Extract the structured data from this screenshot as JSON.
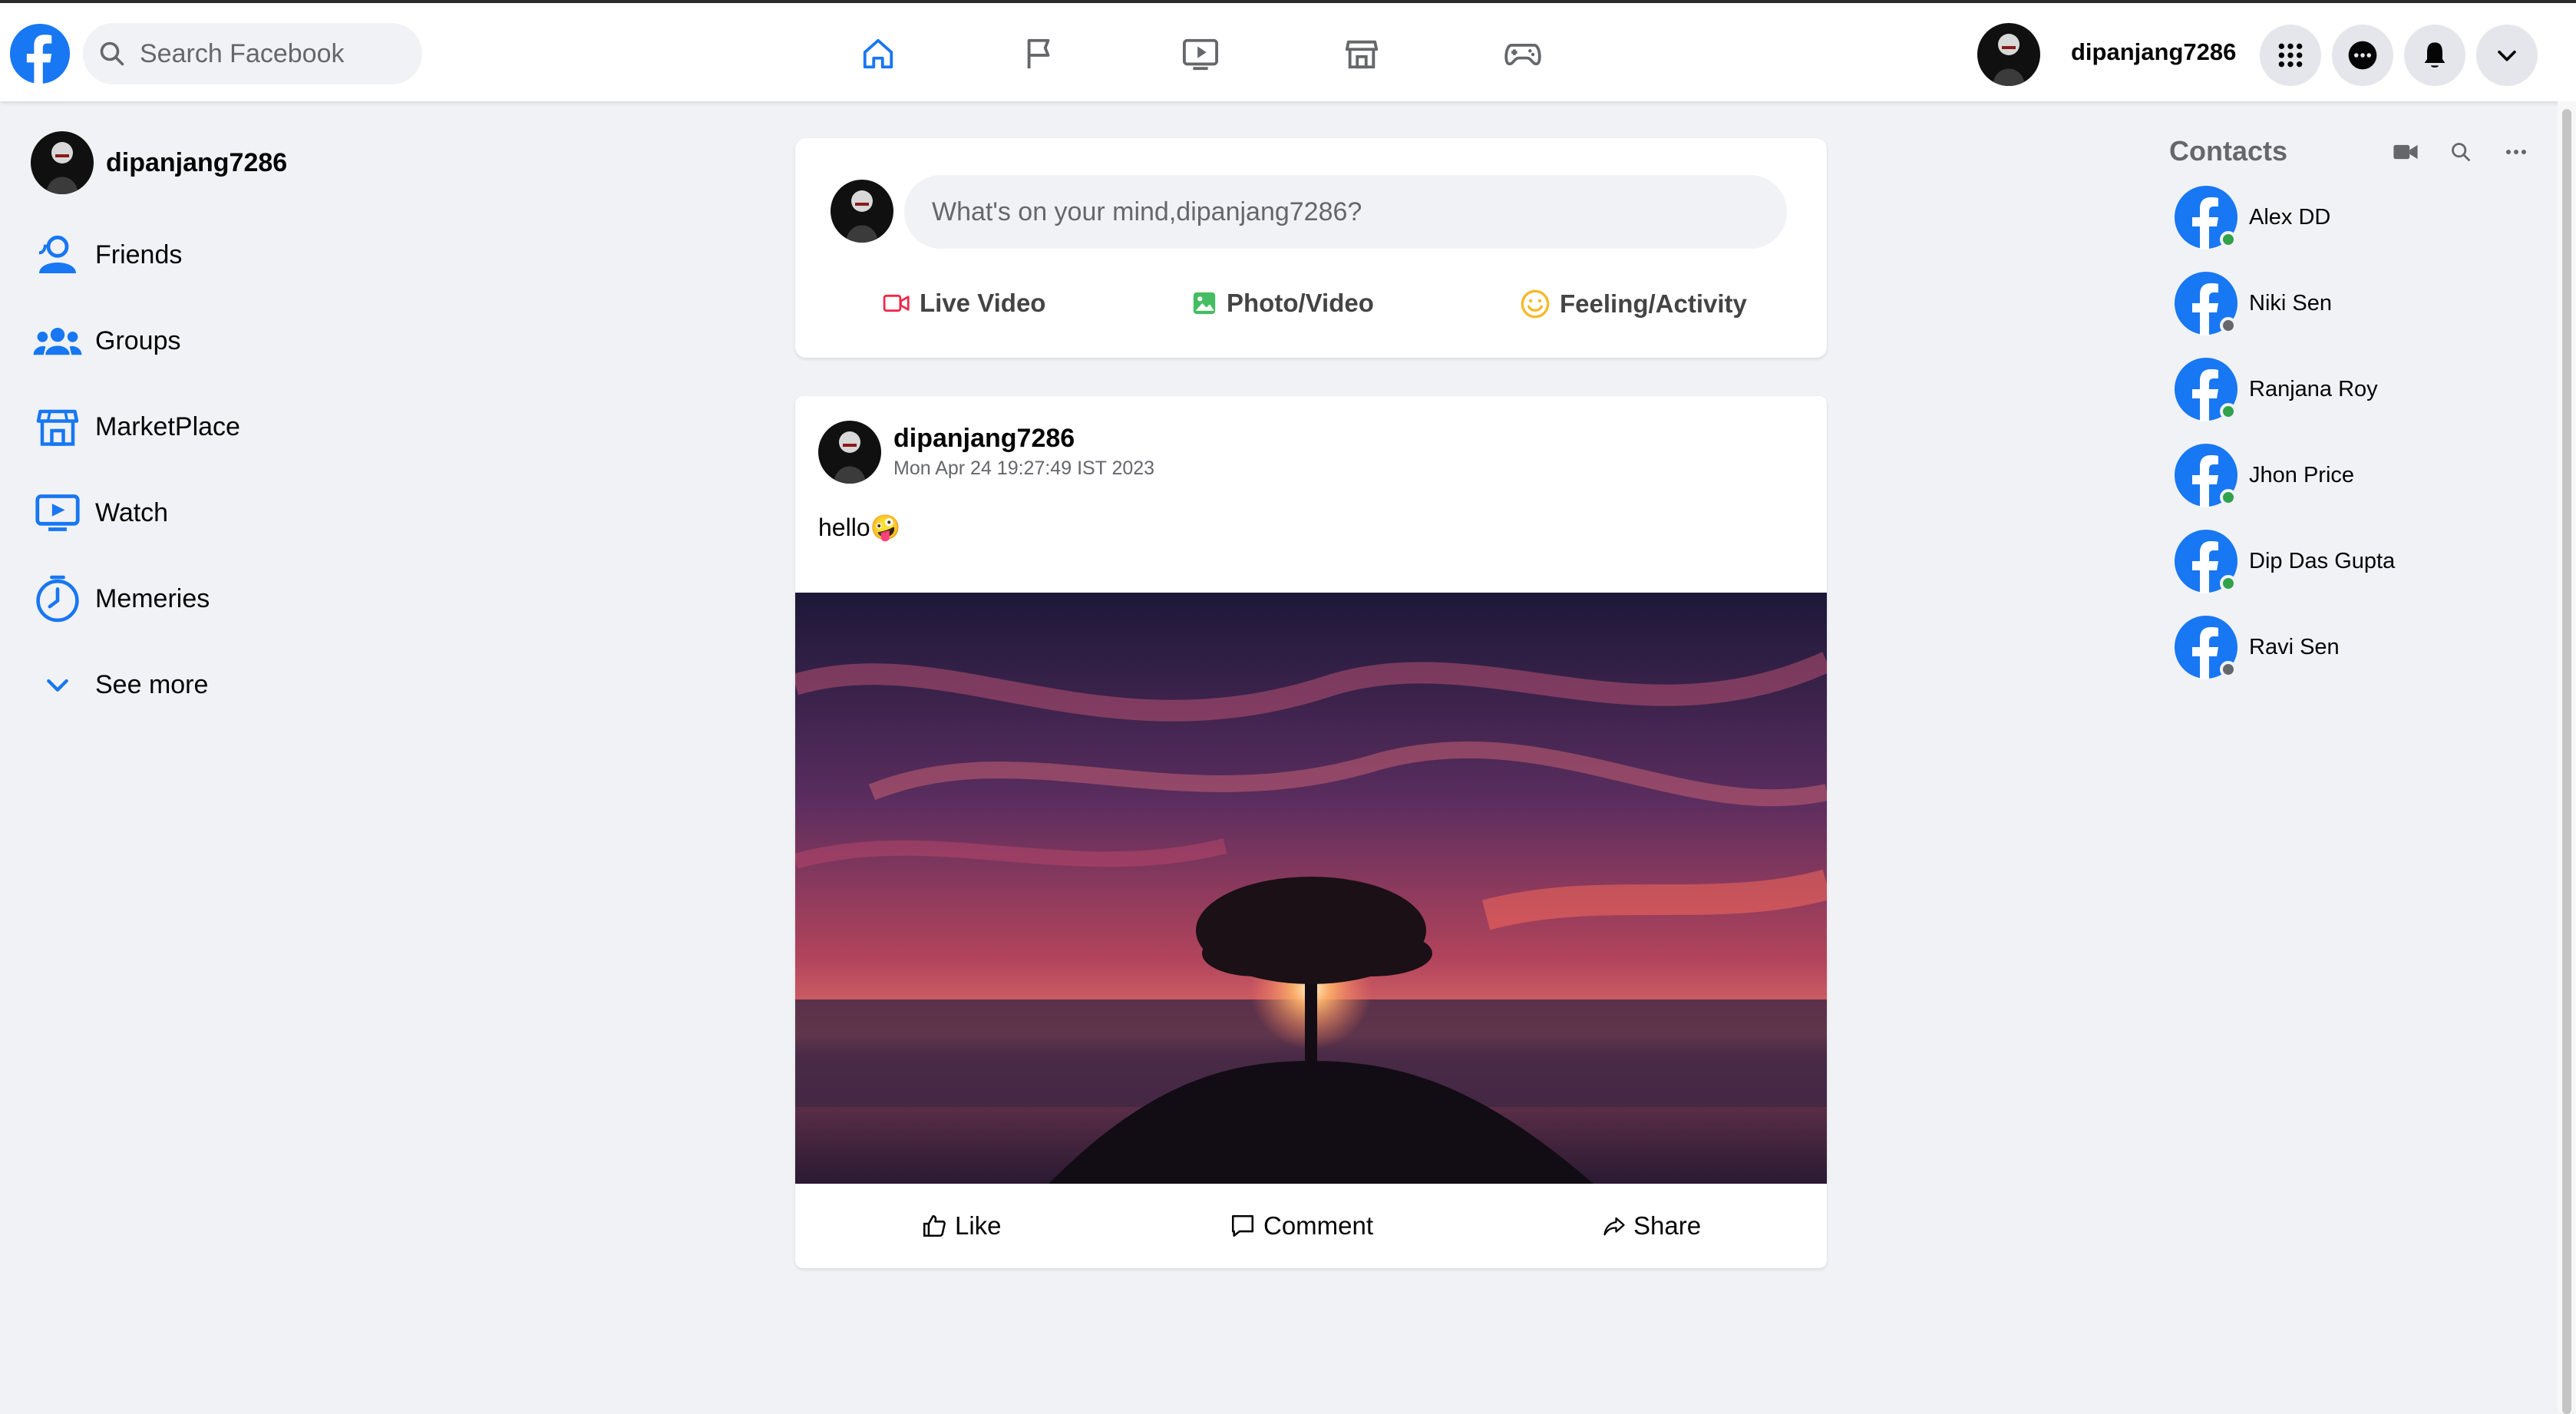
{
  "colors": {
    "brand": "#1877f2",
    "online": "#31a24c",
    "offline": "#65676b",
    "background": "#f0f2f5"
  },
  "header": {
    "search": {
      "placeholder": "Search Facebook",
      "value": ""
    },
    "nav": [
      "home-icon",
      "flag-icon",
      "video-icon",
      "marketplace-icon",
      "gaming-icon"
    ],
    "username": "dipanjang7286",
    "right_icons": [
      "menu-grid-icon",
      "messenger-icon",
      "bell-icon",
      "chevron-down-icon"
    ]
  },
  "sidebar": {
    "profile_name": "dipanjang7286",
    "items": [
      {
        "label": "Friends",
        "icon": "friends-icon"
      },
      {
        "label": "Groups",
        "icon": "groups-icon"
      },
      {
        "label": "MarketPlace",
        "icon": "marketplace-icon"
      },
      {
        "label": "Watch",
        "icon": "watch-icon"
      },
      {
        "label": "Memeries",
        "icon": "memories-icon"
      },
      {
        "label": "See more",
        "icon": "chevron-down-icon"
      }
    ]
  },
  "composer": {
    "placeholder": "What's on your mind,dipanjang7286?",
    "actions": [
      {
        "label": "Live Video",
        "icon": "live-video-icon",
        "color": "#f02849"
      },
      {
        "label": "Photo/Video",
        "icon": "photo-icon",
        "color": "#45bd62"
      },
      {
        "label": "Feeling/Activity",
        "icon": "smile-icon",
        "color": "#f7b928"
      }
    ]
  },
  "post": {
    "author": "dipanjang7286",
    "timestamp": "Mon Apr 24 19:27:49 IST 2023",
    "text": "hello🤪",
    "actions": {
      "like": "Like",
      "comment": "Comment",
      "share": "Share"
    }
  },
  "contacts": {
    "title": "Contacts",
    "list": [
      {
        "name": "Alex DD",
        "online": true
      },
      {
        "name": "Niki Sen",
        "online": false
      },
      {
        "name": "Ranjana Roy",
        "online": true
      },
      {
        "name": "Jhon Price",
        "online": true
      },
      {
        "name": "Dip Das Gupta",
        "online": true
      },
      {
        "name": "Ravi Sen",
        "online": false
      }
    ]
  }
}
